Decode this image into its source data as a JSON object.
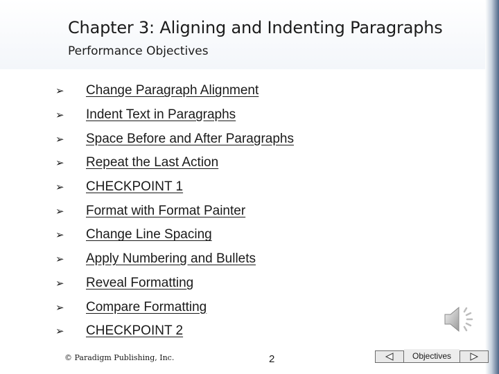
{
  "slide": {
    "title": "Chapter 3: Aligning and Indenting Paragraphs",
    "subtitle": "Performance Objectives",
    "bullet_glyph": "➢",
    "objectives": [
      "Change Paragraph Alignment",
      "Indent Text in Paragraphs",
      "Space Before and After Paragraphs",
      "Repeat the Last Action",
      "CHECKPOINT 1",
      "Format with Format Painter",
      "Change Line Spacing",
      "Apply Numbering and Bullets",
      "Reveal Formatting",
      "Compare Formatting",
      "CHECKPOINT 2"
    ]
  },
  "footer": {
    "copyright": "© Paradigm Publishing, Inc.",
    "page_number": "2"
  },
  "navigation": {
    "label": "Objectives",
    "prev_icon": "triangle-left-icon",
    "next_icon": "triangle-right-icon"
  },
  "audio": {
    "icon": "speaker-icon"
  },
  "colors": {
    "text": "#1a1a1a",
    "accent_edge": "#4d6687"
  }
}
